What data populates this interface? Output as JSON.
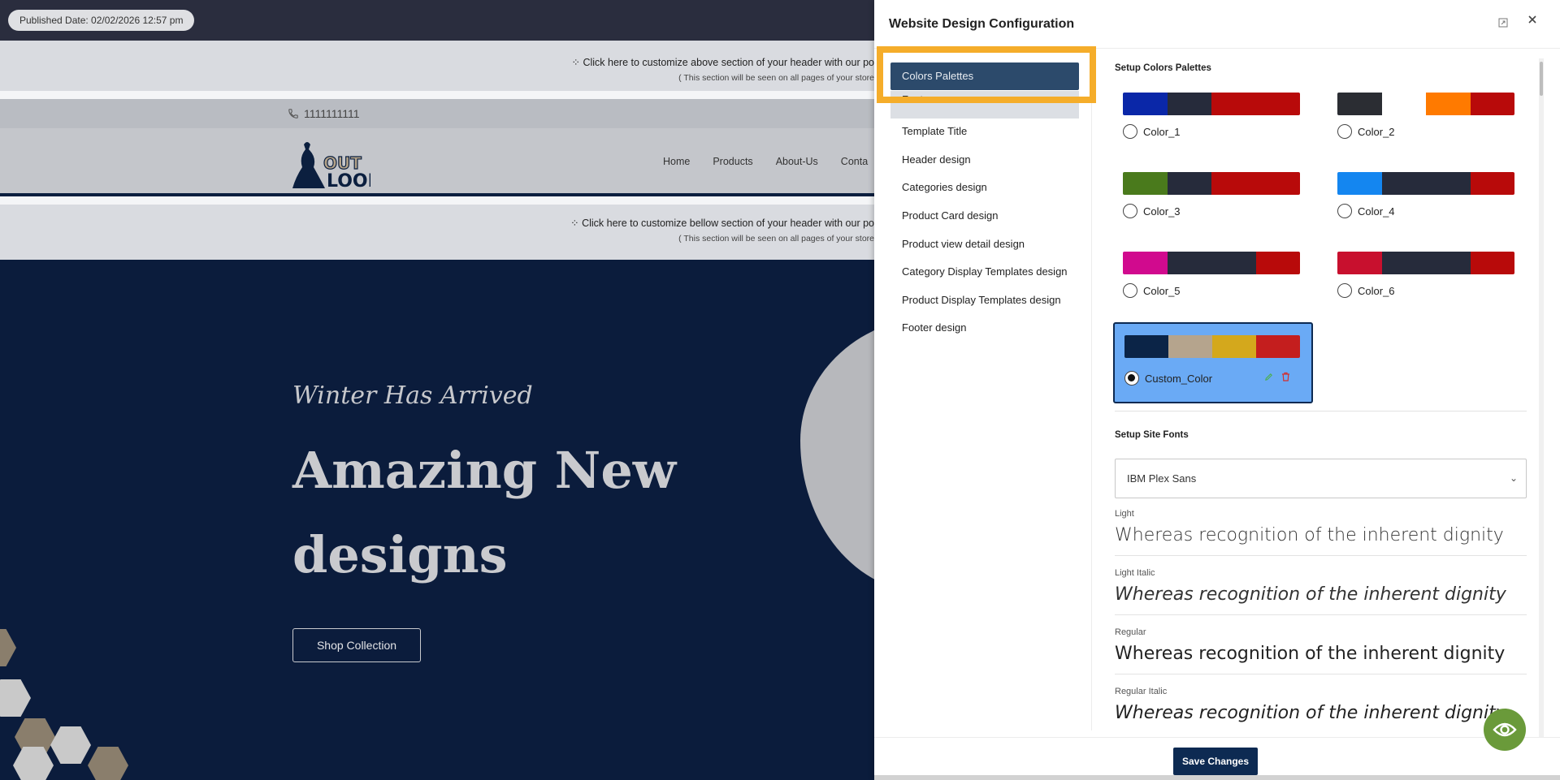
{
  "site_preview": {
    "published_badge": "Published Date: 02/02/2026 12:57 pm",
    "top_customize_line1": "⁘ Click here to customize above section of your header with our po",
    "top_customize_line2": "( This section will be seen on all pages of your store",
    "phone": "1111111111",
    "logo_text": "OUT LOOK",
    "nav_links": [
      "Home",
      "Products",
      "About-Us",
      "Conta"
    ],
    "bottom_customize_line1": "⁘ Click here to customize bellow section of your header with our po",
    "bottom_customize_line2": "( This section will be seen on all pages of your store",
    "hero": {
      "kicker": "Winter Has Arrived",
      "headline": "Amazing New designs",
      "cta": "Shop Collection"
    }
  },
  "panel": {
    "title": "Website Design Configuration",
    "menu": {
      "active": "Colors Palettes",
      "items": [
        "Fonts",
        "Template Title",
        "Header design",
        "Categories design",
        "Product Card design",
        "Product view detail design",
        "Category Display Templates design",
        "Product Display Templates design",
        "Footer design"
      ]
    },
    "colors_section_title": "Setup Colors Palettes",
    "palettes": [
      {
        "name": "Color_1",
        "colors": [
          "#0a27a8",
          "#262b3b",
          "#b80a0a",
          "#b80a0a"
        ],
        "selected": false
      },
      {
        "name": "Color_2",
        "colors": [
          "#2b2d33",
          "#ffffff",
          "#ff7a00",
          "#b80a0a"
        ],
        "selected": false
      },
      {
        "name": "Color_3",
        "colors": [
          "#4a7a1c",
          "#262b3b",
          "#b80a0a",
          "#b80a0a"
        ],
        "selected": false
      },
      {
        "name": "Color_4",
        "colors": [
          "#1486f0",
          "#262b3b",
          "#262b3b",
          "#b80a0a"
        ],
        "selected": false
      },
      {
        "name": "Color_5",
        "colors": [
          "#d10a8e",
          "#262b3b",
          "#262b3b",
          "#b80a0a"
        ],
        "selected": false
      },
      {
        "name": "Color_6",
        "colors": [
          "#c8102e",
          "#262b3b",
          "#262b3b",
          "#b80a0a"
        ],
        "selected": false
      }
    ],
    "custom_palette": {
      "name": "Custom_Color",
      "colors": [
        "#0b2447",
        "#b5a48d",
        "#d4a81c",
        "#c41e1e"
      ],
      "selected": true
    },
    "fonts_section_title": "Setup Site Fonts",
    "font_select_value": "IBM Plex Sans",
    "font_samples": [
      {
        "caption": "Light",
        "text": "Whereas recognition of the inherent dignity"
      },
      {
        "caption": "Light Italic",
        "text": "Whereas recognition of the inherent dignity"
      },
      {
        "caption": "Regular",
        "text": "Whereas recognition of the inherent dignity"
      },
      {
        "caption": "Regular Italic",
        "text": "Whereas recognition of the inherent dignity"
      }
    ],
    "save_button": "Save Changes"
  },
  "colors": {
    "highlight": "#f5ad2a",
    "active_menu": "#2c4a6b",
    "save_button": "#0d2a52",
    "eye_button": "#6a9a3a",
    "hero_bg": "#0b1c3c"
  },
  "icons": {
    "phone": "phone-icon",
    "expand": "expand-icon",
    "close": "close-icon",
    "edit": "pencil-icon",
    "delete": "trash-icon",
    "chevron": "chevron-down-icon",
    "preview": "eye-icon"
  }
}
